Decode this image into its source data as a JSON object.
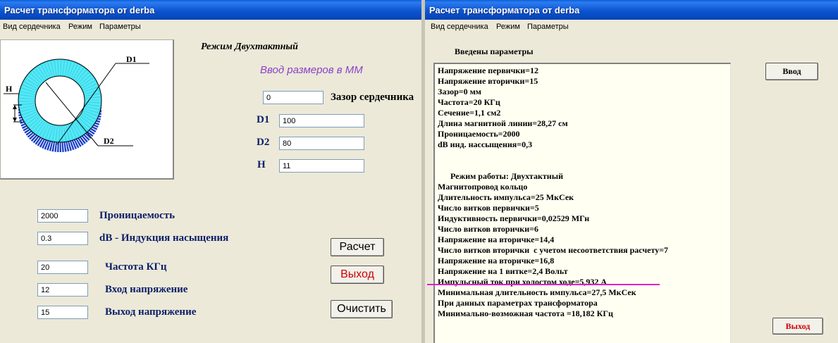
{
  "left_window": {
    "title": "Расчет трансформатора от derba",
    "menu": [
      "Вид сердечника",
      "Режим",
      "Параметры"
    ],
    "diagram_labels": {
      "d1": "D1",
      "d2": "D2",
      "h": "H"
    },
    "mode_title": "Режим Двухтактный",
    "mm_title": "Ввод размеров в ММ",
    "gap": {
      "value": "0",
      "label": "Зазор сердечника"
    },
    "d1": {
      "label": "D1",
      "value": "100"
    },
    "d2": {
      "label": "D2",
      "value": "80"
    },
    "h": {
      "label": "H",
      "value": "11"
    },
    "permeability": {
      "value": "2000",
      "label": "Проницаемость"
    },
    "induction": {
      "value": "0.3",
      "label": "dB - Индукция насыщения"
    },
    "frequency": {
      "value": "20",
      "label": "Частота КГц"
    },
    "voltage_in": {
      "value": "12",
      "label": "Вход напряжение"
    },
    "voltage_out": {
      "value": "15",
      "label": "Выход напряжение"
    },
    "buttons": {
      "calc": "Расчет",
      "exit": "Выход",
      "clear": "Очистить"
    }
  },
  "right_window": {
    "title": "Расчет трансформатора от derba",
    "menu": [
      "Вид сердечника",
      "Режим",
      "Параметры"
    ],
    "entered_title": "Введены параметры",
    "lines": [
      "Напряжение первички=12",
      "Напряжение вторички=15",
      "Зазор=0 мм",
      "Частота=20 КГц",
      "Сечение=1,1 см2",
      "Длина магнитной линии=28,27 см",
      "Проницаемость=2000",
      "dB инд. нассыщения=0,3",
      "",
      "",
      "      Режим работы: Двухтактный",
      "Магнитопровод кольцо",
      "Длительность импульса=25 МкСек",
      "Число витков первички=5",
      "Индуктивность первички=0,02529 МГн",
      "Число витков вторички=6",
      "Напряжение на вторичке=14,4",
      "Число витков вторички  с учетом несоответствия расчету=7",
      "Напряжение на вторичке=16,8",
      "Напряжение на 1 витке=2,4 Вольт",
      "Импульсный ток при холостом ходе=5,932 А",
      "Минимальная длительность импульса=27,5 МкСек",
      "При данных параметрах трансформатора",
      "Минимально-возможная частота =18,182 КГц"
    ],
    "buttons": {
      "enter": "Ввод",
      "exit": "Выход"
    },
    "colors": {
      "highlight": "#e020d0",
      "exit_text": "#cc0000"
    }
  }
}
